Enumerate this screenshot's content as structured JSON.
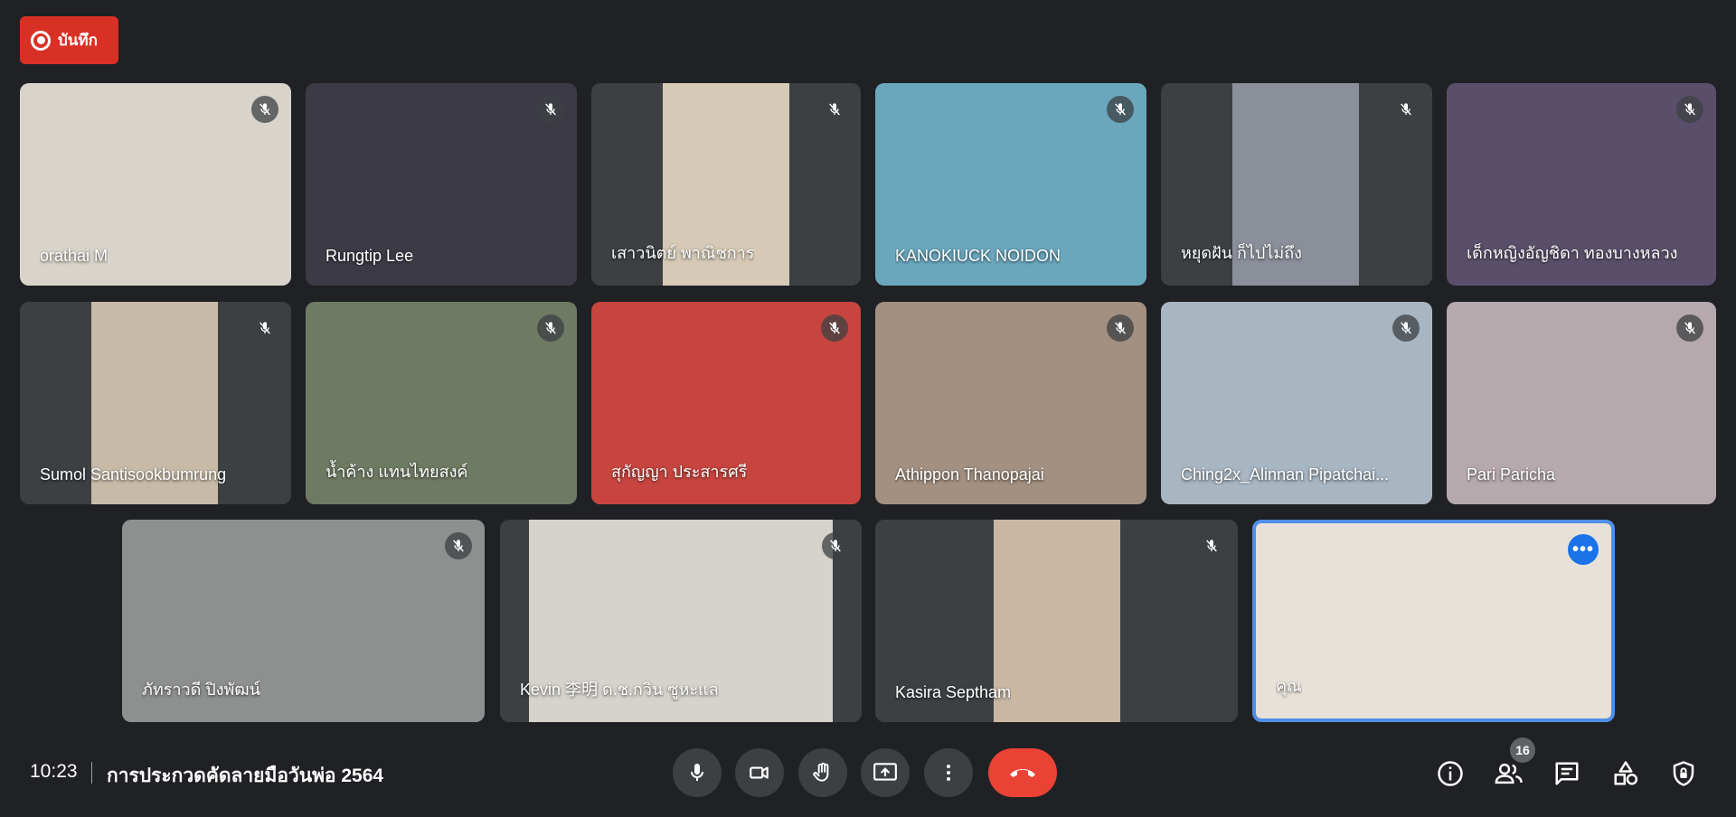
{
  "recording": {
    "label": "บันทึก"
  },
  "participants": [
    {
      "name": "orathai M",
      "bg": "#d9d4cb"
    },
    {
      "name": "Rungtip Lee",
      "bg": "#3b3a45"
    },
    {
      "name": "เสาวนิตย์ พาณิชการ",
      "bg": "#d6cab6"
    },
    {
      "name": "KANOKIUCK NOIDON",
      "bg": "#6aa7bd"
    },
    {
      "name": "หยุดฝัน ก็ไปไม่ถึง",
      "bg": "#8a8f99"
    },
    {
      "name": "เด็กหญิงอัญชิดา ทองบางหลวง",
      "bg": "#5a4f6a"
    },
    {
      "name": "Sumol Santisookbumrung",
      "bg": "#c7bba8"
    },
    {
      "name": "น้ำค้าง แทนไทยสงค์",
      "bg": "#6f7a63"
    },
    {
      "name": "สุกัญญา ประสารศรี",
      "bg": "#c8453f"
    },
    {
      "name": "Athippon Thanopajai",
      "bg": "#a39080"
    },
    {
      "name": "Ching2x_Alinnan Pipatchai...",
      "bg": "#a8b6c2"
    },
    {
      "name": "Pari Paricha",
      "bg": "#b5a9ad"
    },
    {
      "name": "ภัทราวดี ปิงพัฒน์",
      "bg": "#8e9090"
    },
    {
      "name": "Kevin 李明 ด.ช.กวิน ซูหะแล",
      "bg": "#d6d3cc"
    },
    {
      "name": "Kasira Septham",
      "bg": "#c9b7a4"
    },
    {
      "name": "คุณ",
      "bg": "#e7e1d9"
    }
  ],
  "bottom_bar": {
    "time": "10:23",
    "meeting_title": "การประกวดคัดลายมือวันพ่อ 2564",
    "participant_count": "16"
  },
  "controls": {
    "mic": "microphone-icon",
    "camera": "camera-icon",
    "raise_hand": "hand-icon",
    "present": "present-screen-icon",
    "more": "more-vert-icon",
    "hangup": "hangup-icon"
  },
  "right_controls": [
    "info-icon",
    "people-icon",
    "chat-icon",
    "activities-icon",
    "host-controls-icon"
  ],
  "colors": {
    "background": "#202124",
    "recording_red": "#d93025",
    "hangup_red": "#ea4335",
    "self_border": "#4f8fe8",
    "button_bg": "#3c4043"
  }
}
